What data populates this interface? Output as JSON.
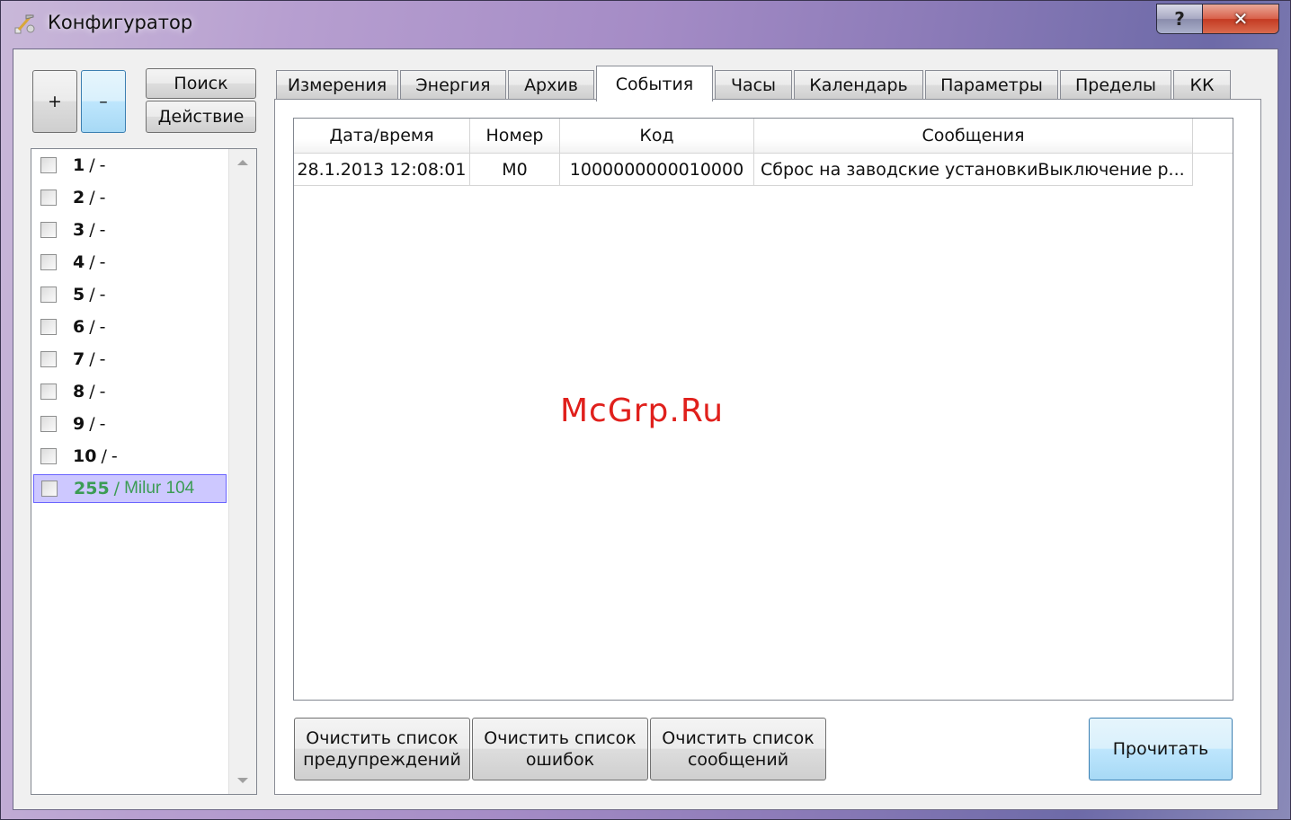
{
  "window": {
    "title": "Конфигуратор",
    "help_label": "?",
    "close_label": "✕",
    "icon": "configurator-app-icon"
  },
  "toolbar": {
    "add_label": "+",
    "remove_label": "–",
    "search_label": "Поиск",
    "action_label": "Действие"
  },
  "devices": [
    {
      "num": "1",
      "sep": "/",
      "name": "-"
    },
    {
      "num": "2",
      "sep": "/",
      "name": "-"
    },
    {
      "num": "3",
      "sep": "/",
      "name": "-"
    },
    {
      "num": "4",
      "sep": "/",
      "name": "-"
    },
    {
      "num": "5",
      "sep": "/",
      "name": "-"
    },
    {
      "num": "6",
      "sep": "/",
      "name": "-"
    },
    {
      "num": "7",
      "sep": "/",
      "name": "-"
    },
    {
      "num": "8",
      "sep": "/",
      "name": "-"
    },
    {
      "num": "9",
      "sep": "/",
      "name": "-"
    },
    {
      "num": "10",
      "sep": "/",
      "name": "-"
    },
    {
      "num": "255",
      "sep": "/",
      "name": "Milur 104",
      "active": true
    }
  ],
  "tabs": [
    {
      "label": "Измерения"
    },
    {
      "label": "Энергия"
    },
    {
      "label": "Архив"
    },
    {
      "label": "События",
      "active": true
    },
    {
      "label": "Часы"
    },
    {
      "label": "Календарь"
    },
    {
      "label": "Параметры"
    },
    {
      "label": "Пределы"
    },
    {
      "label": "КК"
    }
  ],
  "events_table": {
    "columns": [
      "Дата/время",
      "Номер",
      "Код",
      "Сообщения"
    ],
    "rows": [
      [
        "28.1.2013 12:08:01",
        "M0",
        "1000000000010000",
        "Сброс на заводские установкиВыключение р..."
      ]
    ]
  },
  "actions": {
    "clear_warnings_line1": "Очистить список",
    "clear_warnings_line2": "предупреждений",
    "clear_errors_line1": "Очистить список",
    "clear_errors_line2": "ошибок",
    "clear_messages_line1": "Очистить список",
    "clear_messages_line2": "сообщений",
    "read_label": "Прочитать"
  },
  "watermark": "McGrp.Ru"
}
